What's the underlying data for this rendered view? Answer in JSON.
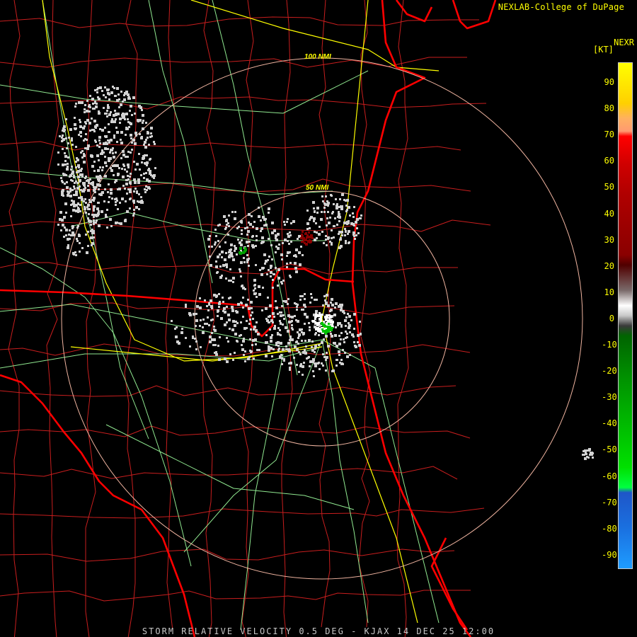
{
  "credit": "NEXLAB-College of DuPage",
  "product_code": "NEXR",
  "unit_label": "[KT]",
  "footer": "STORM RELATIVE VELOCITY 0.5 DEG - KJAX 14 DEC 25 12:00",
  "range_rings": [
    "100 NMI",
    "50 NMI"
  ],
  "legend": {
    "ticks": [
      "90",
      "80",
      "70",
      "60",
      "50",
      "40",
      "30",
      "20",
      "10",
      "0",
      "-10",
      "-20",
      "-30",
      "-40",
      "-50",
      "-60",
      "-70",
      "-80",
      "-90"
    ],
    "colors": {
      "top": "#ffff00",
      "orange": "#ff9a70",
      "red": "#ff0000",
      "darkred": "#8a0000",
      "gray": "#c8c8c8",
      "darkgreen": "#006400",
      "green": "#00e000",
      "blue": "#1e56c8",
      "lightblue": "#1e9cff"
    }
  },
  "colors": {
    "coast": "#ff0000",
    "county": "#c81e1e",
    "road": "#90e890",
    "interstate": "#ffff00",
    "ring": "#f0b4a0",
    "echo": "#d2d2d2"
  }
}
